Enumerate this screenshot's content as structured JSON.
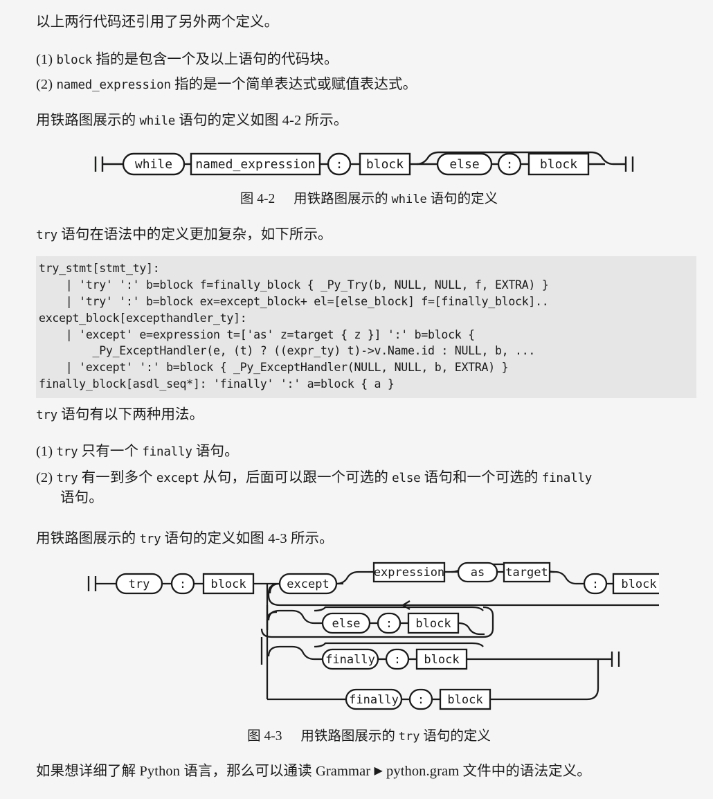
{
  "document": {
    "background_color": "#f4f5f4",
    "code_background_color": "#e6e6e6",
    "text_color": "#1b1b1b"
  },
  "paragraphs": {
    "intro": "以上两行代码还引用了另外两个定义。",
    "item1_prefix": "(1) ",
    "item1_code": "block",
    "item1_rest": " 指的是包含一个及以上语句的代码块。",
    "item2_prefix": "(2) ",
    "item2_code": "named_expression",
    "item2_rest": " 指的是一个简单表达式或赋值表达式。",
    "while_lead_a": "用铁路图展示的 ",
    "while_lead_code": "while",
    "while_lead_b": " 语句的定义如图 4-2 所示。",
    "try_lead_code": "try",
    "try_lead_rest": " 语句在语法中的定义更加复杂，如下所示。",
    "two_uses_code": "try",
    "two_uses_rest": " 语句有以下两种用法。",
    "use1_prefix": "(1) ",
    "use1_code_a": "try",
    "use1_mid": " 只有一个 ",
    "use1_code_b": "finally",
    "use1_rest": " 语句。",
    "use2_prefix": "(2) ",
    "use2_code_a": "try",
    "use2_t1": " 有一到多个 ",
    "use2_code_b": "except",
    "use2_t2": " 从句，后面可以跟一个可选的 ",
    "use2_code_c": "else",
    "use2_t3": " 语句和一个可选的 ",
    "use2_code_d": "finally",
    "use2_line2": "语句。",
    "try_fig_lead_a": "用铁路图展示的 ",
    "try_fig_lead_code": "try",
    "try_fig_lead_b": " 语句的定义如图 4-3 所示。",
    "final_a": "如果想详细了解 Python 语言，那么可以通读 Grammar ",
    "final_triangle": "▶",
    "final_b": " python.gram 文件中的语法定义。"
  },
  "figure1": {
    "caption_number": "图 4-2",
    "caption_text_a": "用铁路图展示的 ",
    "caption_code": "while",
    "caption_text_b": " 语句的定义",
    "nodes": {
      "while": "while",
      "named_expression": "named_expression",
      "colon1": ":",
      "block1": "block",
      "else": "else",
      "colon2": ":",
      "block2": "block"
    }
  },
  "figure2": {
    "caption_number": "图 4-3",
    "caption_text_a": "用铁路图展示的 ",
    "caption_code": "try",
    "caption_text_b": " 语句的定义",
    "nodes": {
      "try": "try",
      "colon_try": ":",
      "block_try": "block",
      "except": "except",
      "expression": "expression",
      "as": "as",
      "target": "target",
      "colon_except": ":",
      "block_except": "block",
      "else": "else",
      "colon_else": ":",
      "block_else": "block",
      "finally1": "finally",
      "colon_finally1": ":",
      "block_finally1": "block",
      "finally2": "finally",
      "colon_finally2": ":",
      "block_finally2": "block"
    }
  },
  "code_block": {
    "language": "python-grammar",
    "lines": [
      "try_stmt[stmt_ty]:",
      "    | 'try' ':' b=block f=finally_block { _Py_Try(b, NULL, NULL, f, EXTRA) }",
      "    | 'try' ':' b=block ex=except_block+ el=[else_block] f=[finally_block]..",
      "except_block[excepthandler_ty]:",
      "    | 'except' e=expression t=['as' z=target { z }] ':' b=block {",
      "        _Py_ExceptHandler(e, (t) ? ((expr_ty) t)->v.Name.id : NULL, b, ...",
      "    | 'except' ':' b=block { _Py_ExceptHandler(NULL, NULL, b, EXTRA) }",
      "finally_block[asdl_seq*]: 'finally' ':' a=block { a }"
    ],
    "text": "try_stmt[stmt_ty]:\n    | 'try' ':' b=block f=finally_block { _Py_Try(b, NULL, NULL, f, EXTRA) }\n    | 'try' ':' b=block ex=except_block+ el=[else_block] f=[finally_block]..\nexcept_block[excepthandler_ty]:\n    | 'except' e=expression t=['as' z=target { z }] ':' b=block {\n        _Py_ExceptHandler(e, (t) ? ((expr_ty) t)->v.Name.id : NULL, b, ...\n    | 'except' ':' b=block { _Py_ExceptHandler(NULL, NULL, b, EXTRA) }\nfinally_block[asdl_seq*]: 'finally' ':' a=block { a }"
  }
}
